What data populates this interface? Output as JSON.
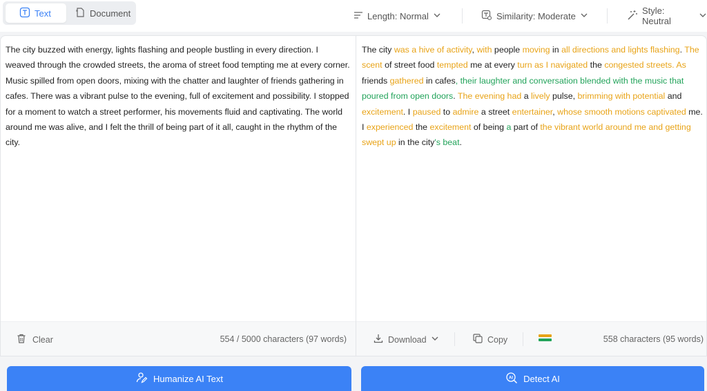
{
  "colors": {
    "accent": "#3b82f6",
    "changed_word": "#e8a317",
    "changed_phrase": "#22a35a"
  },
  "mode_tabs": [
    {
      "label": "Text",
      "icon": "text-icon",
      "active": true
    },
    {
      "label": "Document",
      "icon": "document-icon",
      "active": false
    }
  ],
  "options": {
    "length": "Length: Normal",
    "similarity": "Similarity: Moderate",
    "style": "Style: Neutral"
  },
  "input": {
    "text": "The city buzzed with energy, lights flashing and people bustling in every direction. I weaved through the crowded streets, the aroma of street food tempting me at every corner. Music spilled from open doors, mixing with the chatter and laughter of friends gathering in cafes. There was a vibrant pulse to the evening, full of excitement and possibility. I stopped for a moment to watch a street performer, his movements fluid and captivating. The world around me was alive, and I felt the thrill of being part of it all, caught in the rhythm of the city.",
    "clear_label": "Clear",
    "char_count": "554 / 5000 characters (97 words)"
  },
  "output": {
    "segments": [
      {
        "text": "The city ",
        "type": "plain"
      },
      {
        "text": "was a hive of activity",
        "type": "orange"
      },
      {
        "text": ", ",
        "type": "plain"
      },
      {
        "text": "with",
        "type": "orange"
      },
      {
        "text": " people ",
        "type": "plain"
      },
      {
        "text": "moving",
        "type": "orange"
      },
      {
        "text": " in ",
        "type": "plain"
      },
      {
        "text": "all directions and lights flashing",
        "type": "orange"
      },
      {
        "text": ". ",
        "type": "plain"
      },
      {
        "text": "The scent",
        "type": "orange"
      },
      {
        "text": " of street food ",
        "type": "plain"
      },
      {
        "text": "tempted",
        "type": "orange"
      },
      {
        "text": " me at every ",
        "type": "plain"
      },
      {
        "text": "turn as I navigated",
        "type": "orange"
      },
      {
        "text": " the ",
        "type": "plain"
      },
      {
        "text": "congested streets. As",
        "type": "orange"
      },
      {
        "text": " friends ",
        "type": "plain"
      },
      {
        "text": "gathered",
        "type": "orange"
      },
      {
        "text": " in cafes",
        "type": "plain"
      },
      {
        "text": ", their laughter and conversation blended with the music that poured from open doors",
        "type": "green"
      },
      {
        "text": ". ",
        "type": "plain"
      },
      {
        "text": "The evening had",
        "type": "orange"
      },
      {
        "text": " a ",
        "type": "plain"
      },
      {
        "text": "lively",
        "type": "orange"
      },
      {
        "text": " pulse, ",
        "type": "plain"
      },
      {
        "text": "brimming with potential",
        "type": "orange"
      },
      {
        "text": " and ",
        "type": "plain"
      },
      {
        "text": "excitement",
        "type": "orange"
      },
      {
        "text": ". I ",
        "type": "plain"
      },
      {
        "text": "paused",
        "type": "orange"
      },
      {
        "text": " to ",
        "type": "plain"
      },
      {
        "text": "admire",
        "type": "orange"
      },
      {
        "text": " a street ",
        "type": "plain"
      },
      {
        "text": "entertainer",
        "type": "orange"
      },
      {
        "text": ", ",
        "type": "plain"
      },
      {
        "text": "whose smooth motions captivated",
        "type": "orange"
      },
      {
        "text": " me. I ",
        "type": "plain"
      },
      {
        "text": "experienced",
        "type": "orange"
      },
      {
        "text": " the ",
        "type": "plain"
      },
      {
        "text": "excitement",
        "type": "orange"
      },
      {
        "text": " of being ",
        "type": "plain"
      },
      {
        "text": "a",
        "type": "green"
      },
      {
        "text": " part of ",
        "type": "plain"
      },
      {
        "text": "the vibrant world around me and getting swept up",
        "type": "orange"
      },
      {
        "text": " in the city",
        "type": "plain"
      },
      {
        "text": "'s beat",
        "type": "green"
      },
      {
        "text": ".",
        "type": "plain"
      }
    ],
    "download_label": "Download",
    "copy_label": "Copy",
    "char_count": "558 characters (95 words)"
  },
  "actions": {
    "humanize_label": "Humanize AI Text",
    "detect_label": "Detect AI"
  }
}
